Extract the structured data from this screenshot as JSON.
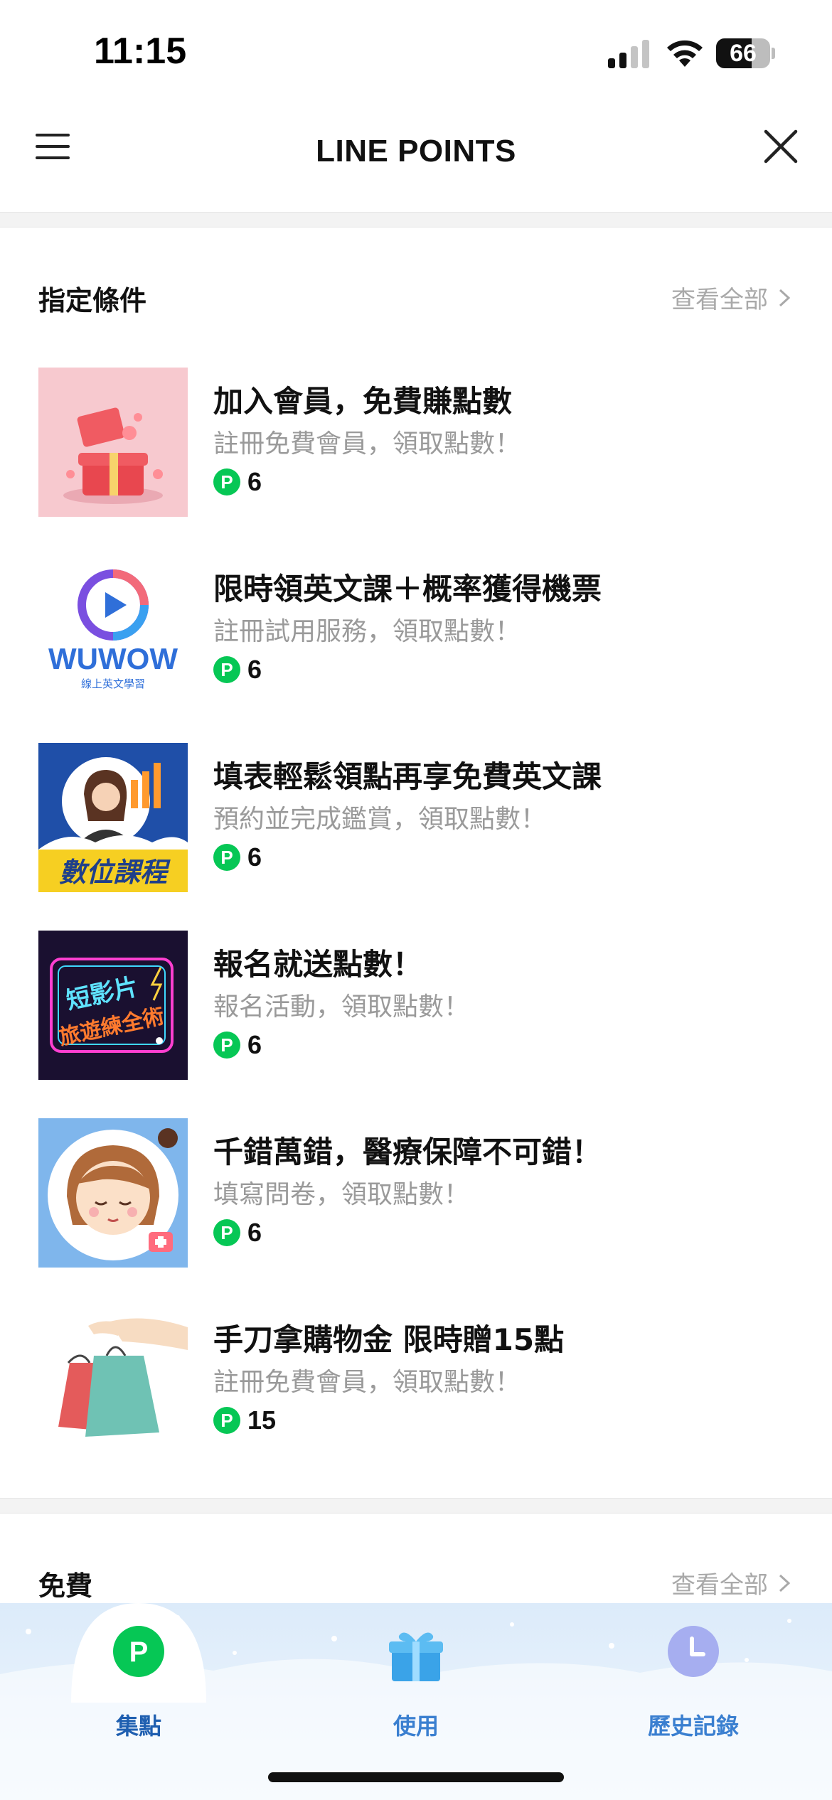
{
  "status_bar": {
    "time": "11:15",
    "battery": "66",
    "battery_level": 0.66
  },
  "header": {
    "title": "LINE POINTS"
  },
  "section_conditions": {
    "title": "指定條件",
    "see_all": "查看全部",
    "offers": [
      {
        "title": "加入會員，免費賺點數",
        "subtitle": "註冊免費會員，領取點數！",
        "points": "6"
      },
      {
        "title": "限時領英文課＋概率獲得機票",
        "subtitle": "註冊試用服務，領取點數！",
        "points": "6",
        "logo_text": "WUWOW",
        "logo_sub": "線上英文學習"
      },
      {
        "title": "填表輕鬆領點再享免費英文課",
        "subtitle": "預約並完成鑑賞，領取點數！",
        "points": "6",
        "banner_text": "數位課程"
      },
      {
        "title": "報名就送點數！",
        "subtitle": "報名活動，領取點數！",
        "points": "6",
        "neon_text_1": "短影片",
        "neon_text_2": "旅遊練全術"
      },
      {
        "title": "千錯萬錯，醫療保障不可錯！",
        "subtitle": "填寫問卷，領取點數！",
        "points": "6"
      },
      {
        "title": "手刀拿購物金 限時贈15點",
        "subtitle": "註冊免費會員，領取點數！",
        "points": "15"
      }
    ]
  },
  "section_free": {
    "title": "免費",
    "see_all": "查看全部"
  },
  "tabbar": {
    "tabs": [
      {
        "label": "集點",
        "icon": "p-coin-icon",
        "active": true
      },
      {
        "label": "使用",
        "icon": "gift-icon",
        "active": false
      },
      {
        "label": "歷史記錄",
        "icon": "clock-icon",
        "active": false
      }
    ],
    "p_glyph": "P"
  },
  "colors": {
    "line_green": "#06c755",
    "tab_blue": "#3a7fd0",
    "muted": "#9a9a9a"
  }
}
